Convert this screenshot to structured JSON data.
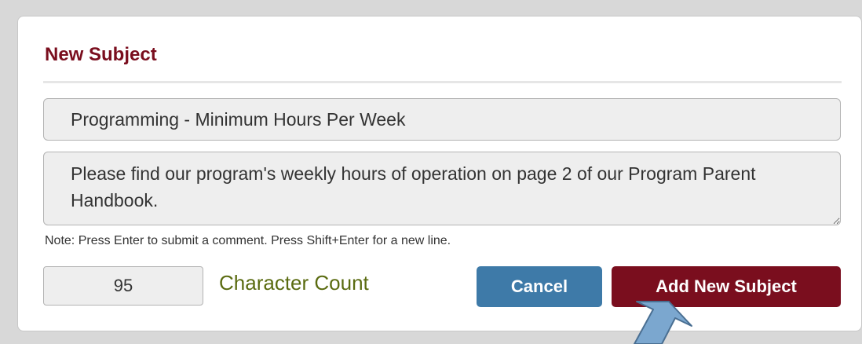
{
  "dialog": {
    "title": "New Subject",
    "subject_value": "Programming - Minimum Hours Per Week",
    "comment_value": "Please find our program's weekly hours of operation on page 2 of our Program Parent Handbook.",
    "note": "Note: Press Enter to submit a comment. Press Shift+Enter for a new line.",
    "character_count": "95",
    "character_count_label": "Character Count",
    "cancel_label": "Cancel",
    "add_label": "Add New Subject"
  },
  "colors": {
    "title": "#7a0e1e",
    "cancel_button": "#3e7aa8",
    "add_button": "#7a0e1e",
    "count_label": "#5a6b10",
    "pointer_arrow": "#7ba7cf"
  },
  "icons": {
    "annotation": "pointer-arrow-icon",
    "textarea_handle": "resize-handle-icon"
  }
}
